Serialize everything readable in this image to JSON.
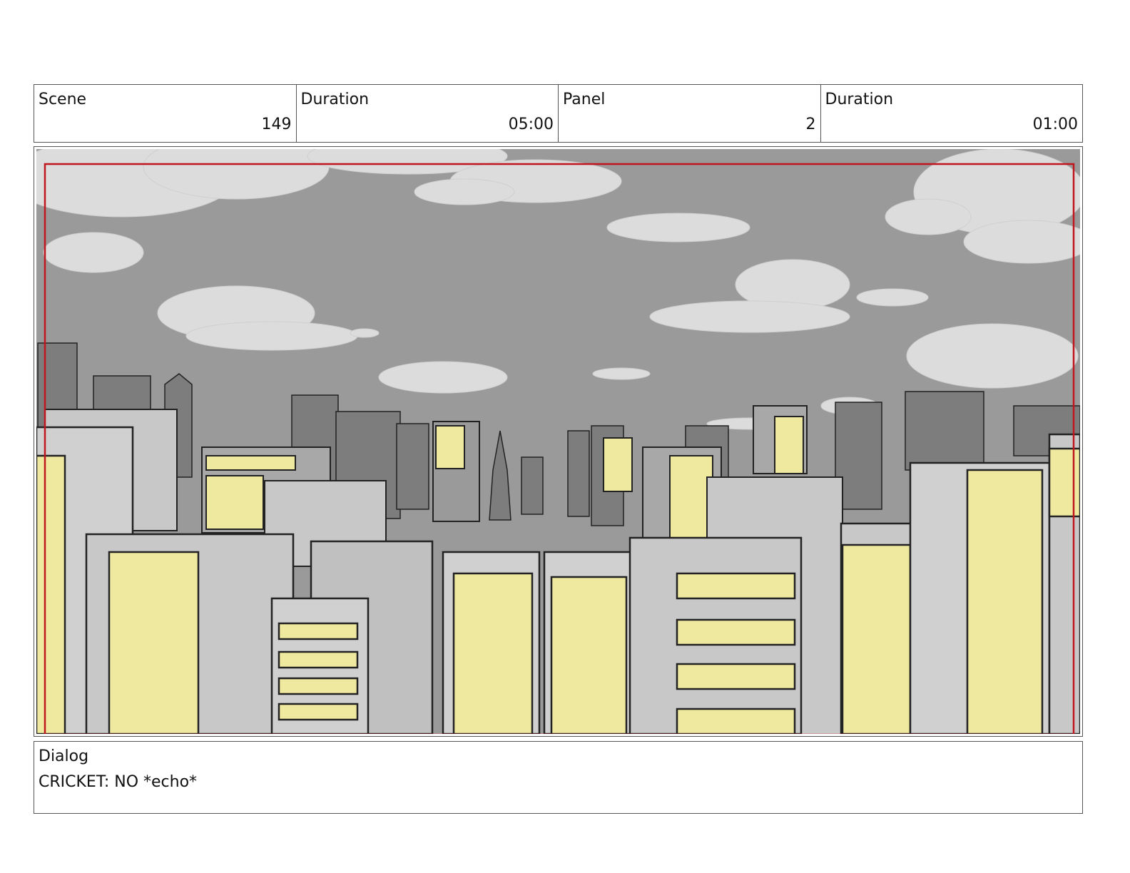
{
  "header": {
    "scene_label": "Scene",
    "scene_value": "149",
    "scene_duration_label": "Duration",
    "scene_duration_value": "05:00",
    "panel_label": "Panel",
    "panel_value": "2",
    "panel_duration_label": "Duration",
    "panel_duration_value": "01:00"
  },
  "dialog": {
    "label": "Dialog",
    "text": "CRICKET: NO *echo*"
  },
  "colors": {
    "sky": "#9a9a9a",
    "cloud": "#dcdcdc",
    "building": "#c8c8c8",
    "lit_window": "#efe9a0",
    "safe_frame": "#c0161e",
    "outline": "#222222"
  }
}
